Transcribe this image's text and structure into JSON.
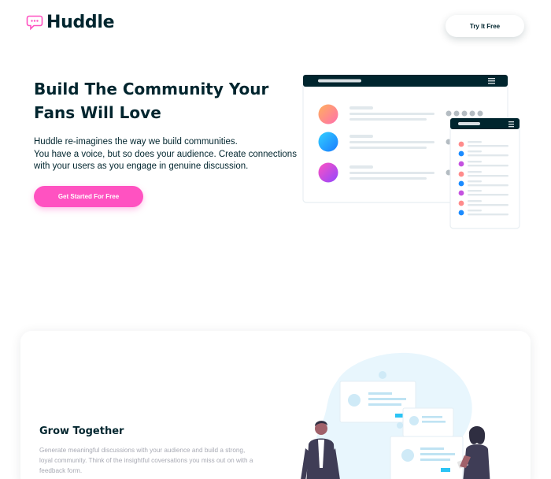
{
  "header": {
    "brand": "Huddle",
    "logo_icon": "chat-bubble-icon",
    "cta_label": "Try It Free"
  },
  "hero": {
    "title": "Build The Community Your Fans Will Love",
    "description_lines": [
      "Huddle re-imagines the way we build communities.",
      "You have a voice, but so does your audience. Create connections",
      "with your users as you engage in genuine discussion."
    ],
    "cta_label": "Get Started For Free"
  },
  "feature": {
    "title": "Grow Together",
    "text_lines": [
      "Generate meaningful discussions with your audience and build a strong,",
      "loyal community. Think of the insightful coversations you miss out on with a",
      "feedback form."
    ]
  },
  "colors": {
    "dark": "#00252e",
    "pink": "#ff52c1",
    "muted": "#a8aab4"
  }
}
